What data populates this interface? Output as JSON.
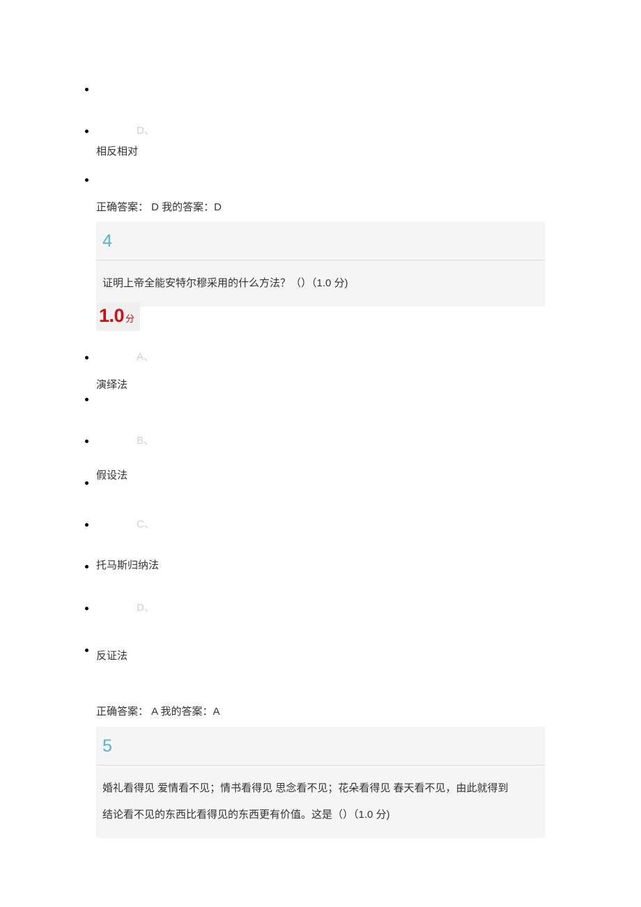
{
  "previous_question_tail": {
    "option": {
      "letter": "D、",
      "text": "相反相对"
    },
    "answer_line": "正确答案： D 我的答案：D"
  },
  "questions": [
    {
      "number": "4",
      "text": "证明上帝全能安特尔穆采用的什么方法？（）（1.0 分)",
      "score": {
        "value": "1.0",
        "unit": "分"
      },
      "options": [
        {
          "letter": "A、",
          "text": "演绎法"
        },
        {
          "letter": "B、",
          "text": "假设法"
        },
        {
          "letter": "C、",
          "text": "托马斯归纳法"
        },
        {
          "letter": "D、",
          "text": "反证法"
        }
      ],
      "answer_line": "正确答案： A 我的答案：A"
    },
    {
      "number": "5",
      "text_line_1": "婚礼看得见 爱情看不见；情书看得见 思念看不见；花朵看得见 春天看不见，由此就得到",
      "text_line_2": "结论看不见的东西比看得见的东西更有价值。这是（）（1.0 分)"
    }
  ],
  "colors": {
    "question_number": "#4fb3e0",
    "score_red": "#cc1111",
    "panel_background": "#f5f5f5",
    "option_letter_gray": "#d0d0d0"
  }
}
